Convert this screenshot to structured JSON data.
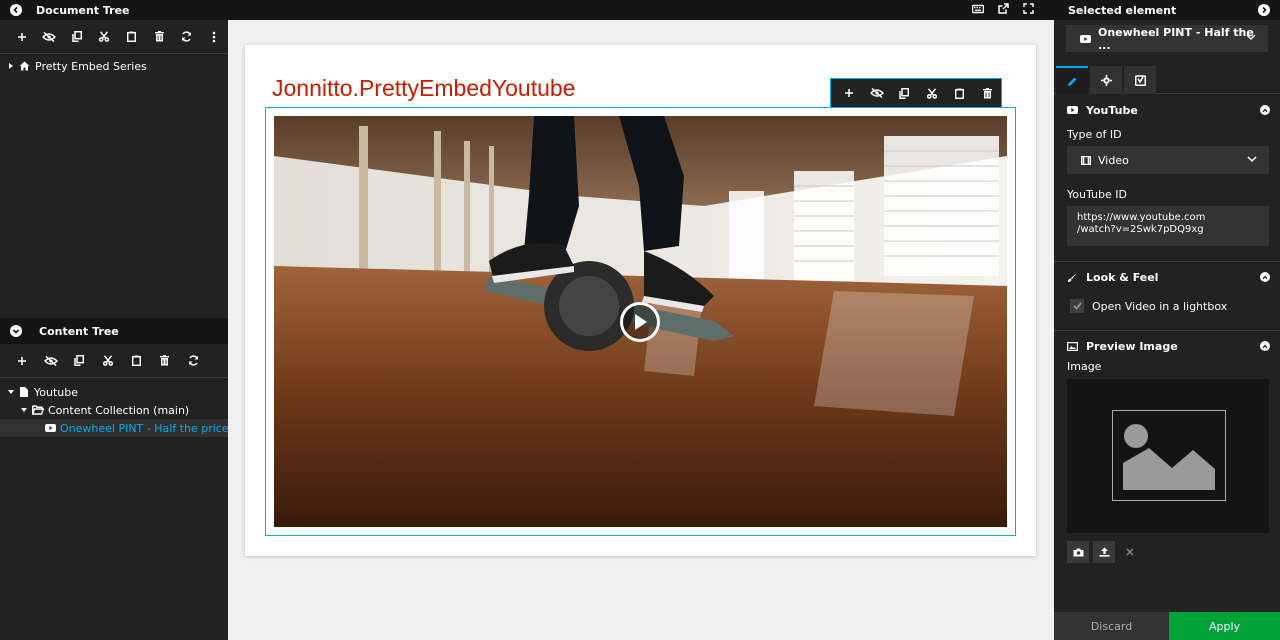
{
  "header": {
    "left_title": "Document Tree",
    "right_title": "Selected element"
  },
  "document_tree": {
    "items": [
      {
        "label": "Pretty Embed Series",
        "icon": "home-icon"
      }
    ]
  },
  "content_tree": {
    "title": "Content Tree",
    "items": [
      {
        "label": "Youtube",
        "icon": "document-icon"
      },
      {
        "label": "Content Collection (main)",
        "icon": "folder-open-icon"
      },
      {
        "label": "Onewheel PINT - Half the price! H...",
        "icon": "youtube-icon"
      }
    ]
  },
  "canvas": {
    "page_title": "Jonnitto.PrettyEmbedYoutube"
  },
  "inspector": {
    "selected_element": "Onewheel PINT - Half the ...",
    "sections": {
      "youtube": {
        "title": "YouTube",
        "type_label": "Type of ID",
        "type_value": "Video",
        "id_label": "YouTube ID",
        "id_value": "https://www.youtube.com\n/watch?v=2Swk7pDQ9xg"
      },
      "look": {
        "title": "Look & Feel",
        "lightbox_label": "Open Video in a lightbox",
        "lightbox_checked": true
      },
      "preview": {
        "title": "Preview Image",
        "image_label": "Image"
      }
    },
    "discard_label": "Discard",
    "apply_label": "Apply"
  },
  "colors": {
    "accent": "#00adee",
    "apply": "#00a338",
    "title_red": "#cc1b00"
  }
}
